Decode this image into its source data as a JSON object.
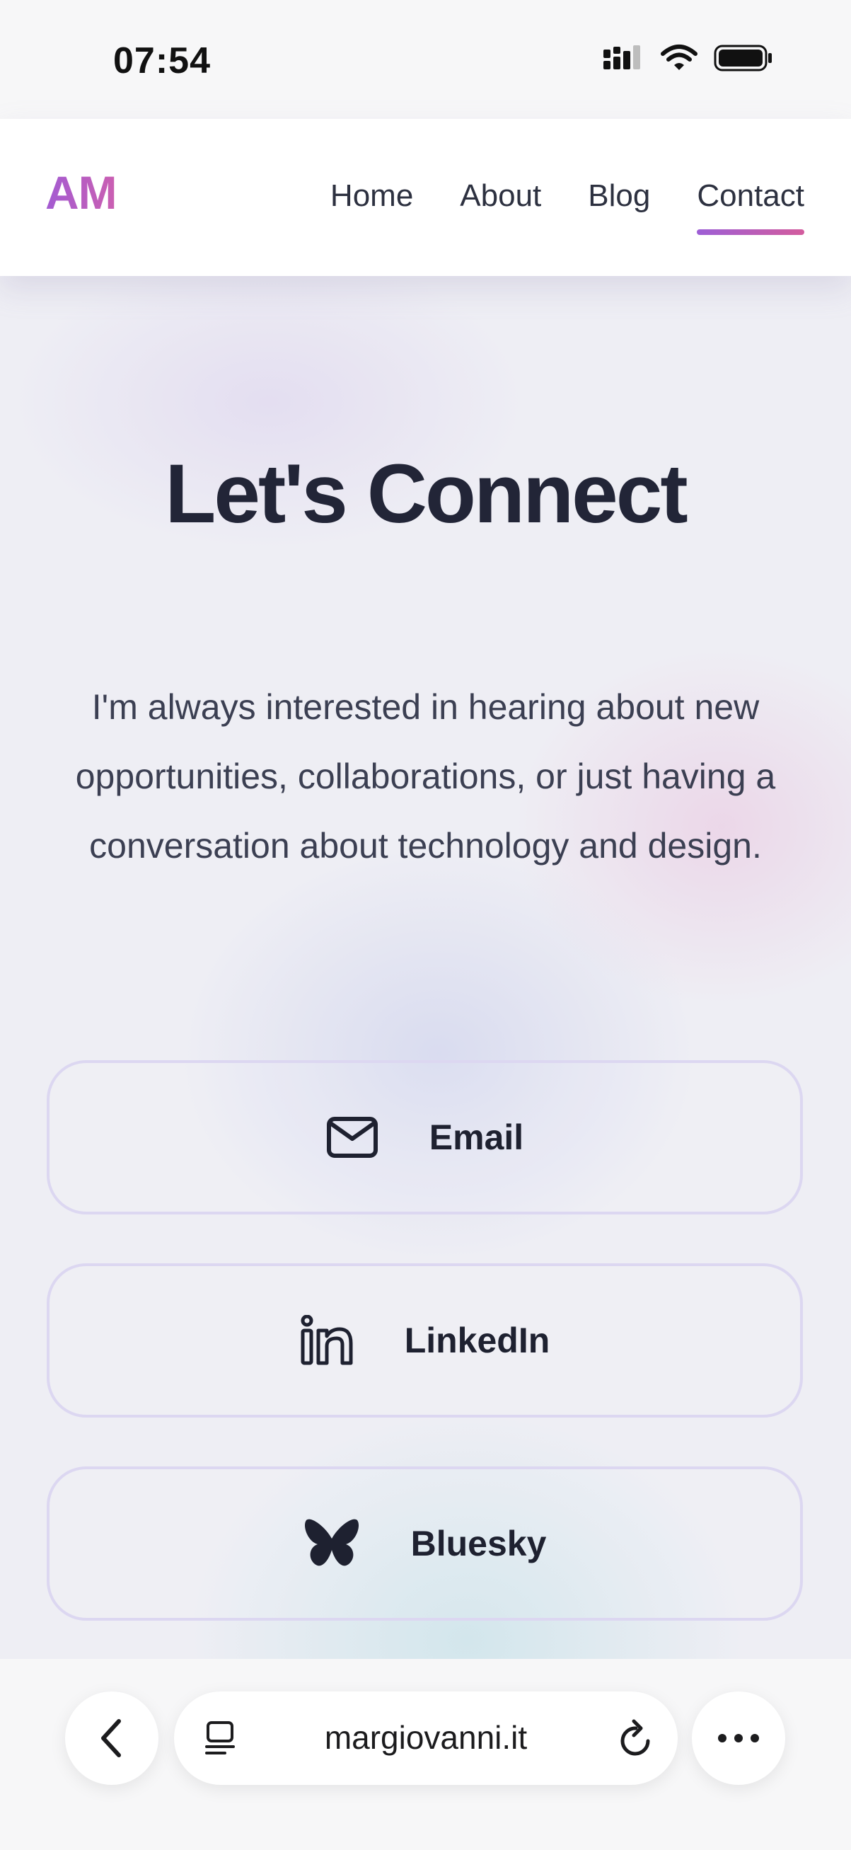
{
  "status_bar": {
    "time": "07:54"
  },
  "header": {
    "logo": "AM",
    "nav": [
      {
        "label": "Home"
      },
      {
        "label": "About"
      },
      {
        "label": "Blog"
      },
      {
        "label": "Contact",
        "active": true
      }
    ]
  },
  "hero": {
    "title": "Let's Connect",
    "intro": "I'm always interested in hearing about new opportunities, collaborations, or just having a conversation about technology and design."
  },
  "contacts": [
    {
      "label": "Email",
      "icon": "envelope-icon"
    },
    {
      "label": "LinkedIn",
      "icon": "linkedin-icon"
    },
    {
      "label": "Bluesky",
      "icon": "butterfly-icon"
    }
  ],
  "browser": {
    "url": "margiovanni.it"
  },
  "colors": {
    "accent_start": "#9d5ed6",
    "accent_end": "#d35c9d",
    "text_dark": "#222537"
  }
}
